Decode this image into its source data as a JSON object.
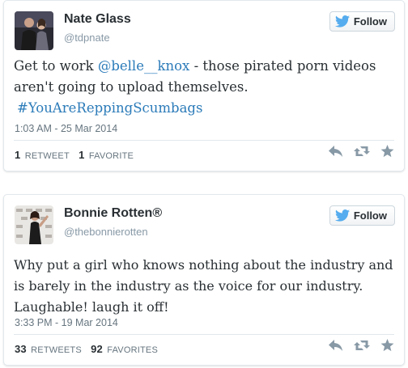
{
  "tweets": [
    {
      "name": "Nate Glass",
      "handle": "@tdpnate",
      "follow_label": "Follow",
      "text_before": "Get to work ",
      "mention": "@belle__knox",
      "text_after": " - those pirated porn videos aren't going to upload themselves.",
      "hashtag": "#YouAreReppingScumbags",
      "time": "1:03 AM - 25 Mar 2014",
      "retweet_count": "1",
      "retweet_label": "RETWEET",
      "favorite_count": "1",
      "favorite_label": "FAVORITE"
    },
    {
      "name": "Bonnie Rotten®",
      "handle": "@thebonnierotten",
      "follow_label": "Follow",
      "text": "Why put a girl who knows nothing about the industry and is barely in the industry as the voice for our industry. Laughable! laugh it off!",
      "time": "3:33 PM - 19 Mar 2014",
      "retweet_count": "33",
      "retweet_label": "RETWEETS",
      "favorite_count": "92",
      "favorite_label": "FAVORITES"
    }
  ],
  "colors": {
    "link": "#2b7bb9",
    "twitter_bird": "#55acee",
    "icon_gray": "#8899a6"
  },
  "icons": [
    "twitter-bird-icon",
    "reply-icon",
    "retweet-icon",
    "favorite-star-icon"
  ]
}
